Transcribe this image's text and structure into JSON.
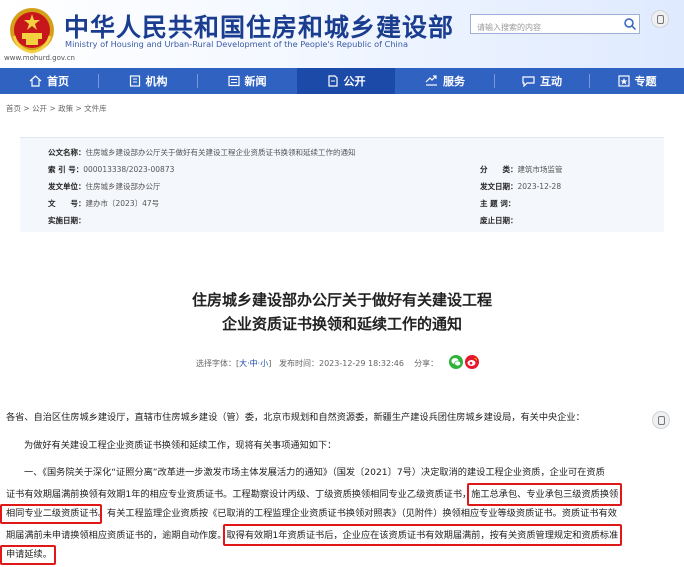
{
  "header": {
    "site_name_cn": "中华人民共和国住房和城乡建设部",
    "site_name_en": "Ministry of Housing and Urban-Rural Development of the People's Republic of China",
    "url": "www.mohurd.gov.cn",
    "search_placeholder": "请输入搜索的内容"
  },
  "nav": {
    "items": [
      {
        "label": "首页",
        "icon": "home-icon"
      },
      {
        "label": "机构",
        "icon": "building-icon"
      },
      {
        "label": "新闻",
        "icon": "news-icon"
      },
      {
        "label": "公开",
        "icon": "document-icon"
      },
      {
        "label": "服务",
        "icon": "service-icon"
      },
      {
        "label": "互动",
        "icon": "chat-icon"
      },
      {
        "label": "专题",
        "icon": "topic-icon"
      }
    ],
    "active": "公开"
  },
  "breadcrumb": {
    "home": "首页",
    "sep": " > ",
    "open": "公开",
    "policy": "政策",
    "library": "文件库"
  },
  "meta": {
    "doc_name_label": "公文名称：",
    "doc_name": "住房城乡建设部办公厅关于做好有关建设工程企业资质证书换领和延续工作的通知",
    "index_label": "索 引 号：",
    "index": "000013338/2023-00873",
    "category_label": "分　　类：",
    "category": "建筑市场监管",
    "issuer_label": "发文单位：",
    "issuer": "住房城乡建设部办公厅",
    "date_label": "发文日期：",
    "date": "2023-12-28",
    "docno_label": "文　　号：",
    "docno": "建办市〔2023〕47号",
    "subject_label": "主 题 词：",
    "subject": "",
    "effective_label": "实施日期：",
    "effective": "",
    "expiry_label": "废止日期：",
    "expiry": ""
  },
  "article": {
    "title_line1": "住房城乡建设部办公厅关于做好有关建设工程",
    "title_line2": "企业资质证书换领和延续工作的通知",
    "font_label": "选择字体：[",
    "font_large": "大",
    "font_mid": "中",
    "font_small": "小",
    "font_end": "]",
    "publish_label": "发布时间：",
    "publish_time": "2023-12-29 18:32:46",
    "share_label": "分享：",
    "para1": "各省、自治区住房城乡建设厅，直辖市住房城乡建设（管）委，北京市规划和自然资源委，新疆生产建设兵团住房城乡建设局，有关中央企业：",
    "para2": "为做好有关建设工程企业资质证书换领和延续工作，现将有关事项通知如下：",
    "para3_line1": "一、《国务院关于深化“证照分离”改革进一步激发市场主体发展活力的通知》（国发〔2021〕7号）决定取消的建设工程企业资质，企业可在资质",
    "para3_line2a": "证书有效期届满前换领有效期1年的相应专业资质证书。工程勘察设计丙级、丁级资质换领相同专业乙级资质证书，",
    "para3_line2b": "施工总承包、专业承包三级资质换领",
    "para3_line3a": "相同专业二级资质证书",
    "para3_line3b": "。有关工程监理企业资质按《已取消的工程监理企业资质证书换领对照表》（见附件）换领相应专业等级资质证书。资质证书有效",
    "para3_line4a": "期届满前未申请换领相应资质证书的，逾期自动作废。",
    "para3_line4b": "取得有效期1年资质证书后，企业应在该资质证书有效期届满前，按有关资质管理规定和资质标准",
    "para3_line5": "申请延续。"
  },
  "colors": {
    "primary": "#3062c2",
    "active": "#1b4aa8",
    "highlight": "#e01818",
    "title": "#1b3d8f"
  }
}
